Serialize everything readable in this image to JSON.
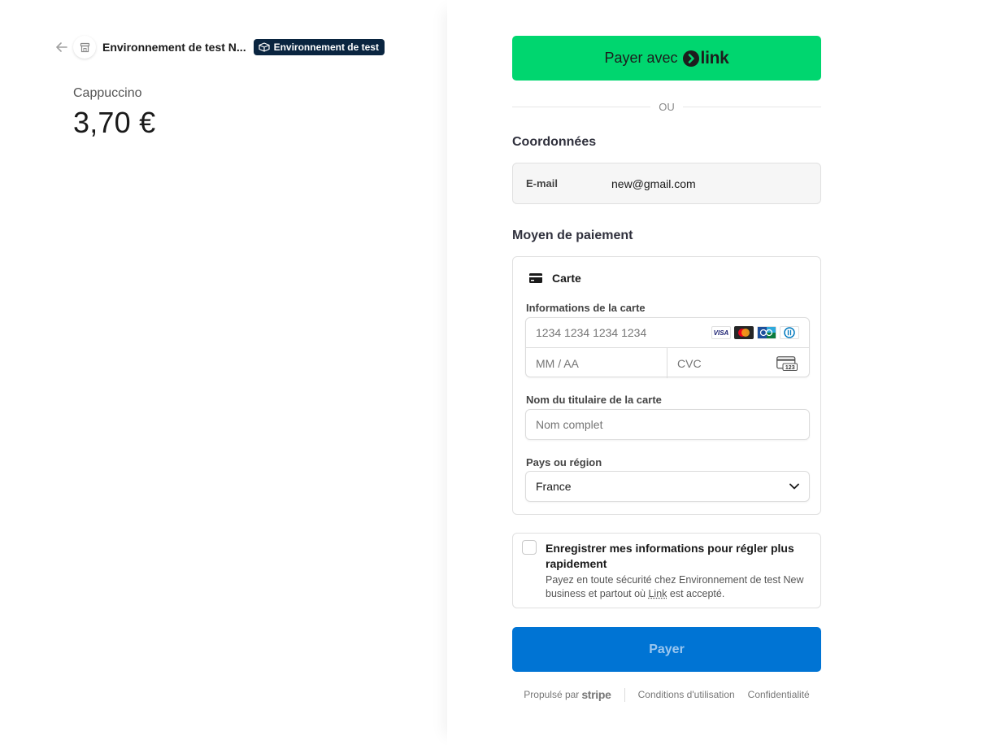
{
  "merchant": {
    "name": "Environnement de test N...",
    "test_badge": "Environnement de test"
  },
  "product": {
    "name": "Cappuccino",
    "price": "3,70 €"
  },
  "link_button": {
    "label": "Payer avec",
    "brand": "link",
    "color": "#00d66f"
  },
  "divider": "OU",
  "contact": {
    "title": "Coordonnées",
    "email_label": "E-mail",
    "email_value": "new@gmail.com"
  },
  "payment": {
    "title": "Moyen de paiement",
    "method_label": "Carte",
    "card_info_label": "Informations de la carte",
    "card_number_placeholder": "1234 1234 1234 1234",
    "expiry_placeholder": "MM / AA",
    "cvc_placeholder": "CVC",
    "card_brands": [
      "visa-icon",
      "mastercard-icon",
      "cartes-bancaires-icon",
      "diners-icon"
    ],
    "cvc_icon_text": "123",
    "holder_label": "Nom du titulaire de la carte",
    "holder_placeholder": "Nom complet",
    "country_label": "Pays ou région",
    "country_value": "France"
  },
  "save_info": {
    "title": "Enregistrer mes informations pour régler plus rapidement",
    "desc_before": "Payez en toute sécurité chez Environnement de test New business et partout où ",
    "desc_link": "Link",
    "desc_after": " est accepté."
  },
  "pay_button": {
    "label": "Payer",
    "color": "#0074d4"
  },
  "footer": {
    "powered_by": "Propulsé par",
    "stripe": "stripe",
    "terms": "Conditions d'utilisation",
    "privacy": "Confidentialité"
  }
}
